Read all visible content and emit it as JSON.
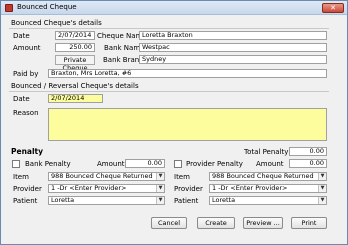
{
  "window": {
    "title": "Bounced Cheque",
    "close_label": "✕"
  },
  "bounced_details": {
    "heading": "Bounced Cheque's details",
    "date_label": "Date",
    "date_value": "2/07/2014",
    "cheque_name_label": "Cheque Name",
    "cheque_name_value": "Loretta Braxton",
    "amount_label": "Amount",
    "amount_value": "250.00",
    "bank_name_label": "Bank Name",
    "bank_name_value": "Westpac",
    "payment_type": "Private Cheque",
    "bank_branch_label": "Bank Branch",
    "bank_branch_value": "Sydney",
    "paid_by_label": "Paid by",
    "paid_by_value": "Braxton, Mrs Loretta, #6"
  },
  "reversal_details": {
    "heading": "Bounced / Reversal Cheque's details",
    "date_label": "Date",
    "date_value": "2/07/2014",
    "reason_label": "Reason",
    "reason_value": ""
  },
  "penalty": {
    "heading": "Penalty",
    "total_label": "Total Penalty",
    "total_value": "0.00",
    "bank": {
      "checkbox_label": "Bank Penalty",
      "amount_label": "Amount",
      "amount_value": "0.00",
      "item_label": "Item",
      "item_value": "988 Bounced Cheque Returned",
      "provider_label": "Provider",
      "provider_value": "1 -Dr <Enter Provider>",
      "patient_label": "Patient",
      "patient_value": "Loretta"
    },
    "provider": {
      "checkbox_label": "Provider Penalty",
      "amount_label": "Amount",
      "amount_value": "0.00",
      "item_label": "Item",
      "item_value": "988 Bounced Cheque Returned",
      "provider_label": "Provider",
      "provider_value": "1 -Dr <Enter Provider>",
      "patient_label": "Patient",
      "patient_value": "Loretta"
    }
  },
  "buttons": {
    "cancel": "Cancel",
    "create": "Create",
    "preview": "Preview ...",
    "print": "Print"
  },
  "icons": {
    "window_icon": "bounced-cheque-icon",
    "dropdown_arrow": "▼"
  }
}
